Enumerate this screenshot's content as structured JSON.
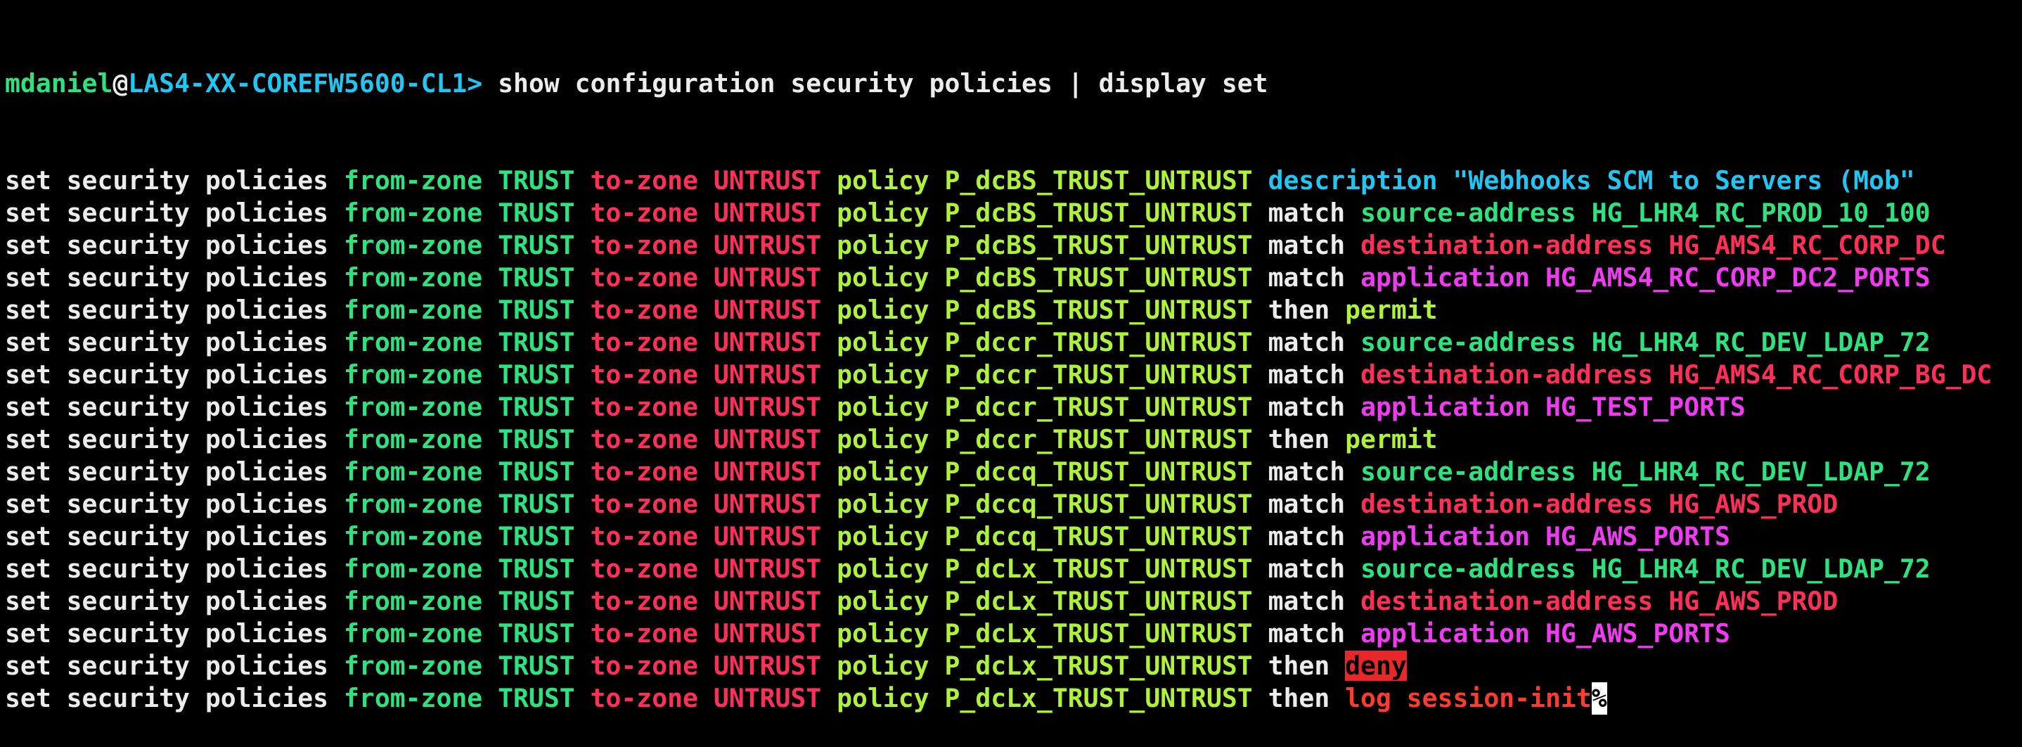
{
  "prompt": {
    "user": "mdaniel",
    "at": "@",
    "host": "LAS4-XX-COREFW5600-CL1",
    "symbol": "> ",
    "command": "show configuration security policies | display set"
  },
  "kw": {
    "set": "set security policies ",
    "from_zone": "from-zone ",
    "from_val": "TRUST ",
    "to_zone": "to-zone ",
    "to_val": "UNTRUST ",
    "policy": "policy ",
    "match": "match ",
    "then": "then "
  },
  "lines": [
    {
      "name": "P_dcBS_TRUST_UNTRUST ",
      "type": "description",
      "label": "description ",
      "value": "\"Webhooks SCM to Servers (Mob\""
    },
    {
      "name": "P_dcBS_TRUST_UNTRUST ",
      "type": "source",
      "label": "source-address ",
      "value": "HG_LHR4_RC_PROD_10_100"
    },
    {
      "name": "P_dcBS_TRUST_UNTRUST ",
      "type": "destination",
      "label": "destination-address ",
      "value": "HG_AMS4_RC_CORP_DC"
    },
    {
      "name": "P_dcBS_TRUST_UNTRUST ",
      "type": "application",
      "label": "application ",
      "value": "HG_AMS4_RC_CORP_DC2_PORTS"
    },
    {
      "name": "P_dcBS_TRUST_UNTRUST ",
      "type": "permit",
      "value": "permit"
    },
    {
      "name": "P_dccr_TRUST_UNTRUST ",
      "type": "source",
      "label": "source-address ",
      "value": "HG_LHR4_RC_DEV_LDAP_72"
    },
    {
      "name": "P_dccr_TRUST_UNTRUST ",
      "type": "destination",
      "label": "destination-address ",
      "value": "HG_AMS4_RC_CORP_BG_DC"
    },
    {
      "name": "P_dccr_TRUST_UNTRUST ",
      "type": "application",
      "label": "application ",
      "value": "HG_TEST_PORTS"
    },
    {
      "name": "P_dccr_TRUST_UNTRUST ",
      "type": "permit",
      "value": "permit"
    },
    {
      "name": "P_dccq_TRUST_UNTRUST ",
      "type": "source",
      "label": "source-address ",
      "value": "HG_LHR4_RC_DEV_LDAP_72"
    },
    {
      "name": "P_dccq_TRUST_UNTRUST ",
      "type": "destination",
      "label": "destination-address ",
      "value": "HG_AWS_PROD"
    },
    {
      "name": "P_dccq_TRUST_UNTRUST ",
      "type": "application",
      "label": "application ",
      "value": "HG_AWS_PORTS"
    },
    {
      "name": "P_dcLx_TRUST_UNTRUST ",
      "type": "source",
      "label": "source-address ",
      "value": "HG_LHR4_RC_DEV_LDAP_72"
    },
    {
      "name": "P_dcLx_TRUST_UNTRUST ",
      "type": "destination",
      "label": "destination-address ",
      "value": "HG_AWS_PROD"
    },
    {
      "name": "P_dcLx_TRUST_UNTRUST ",
      "type": "application",
      "label": "application ",
      "value": "HG_AWS_PORTS"
    },
    {
      "name": "P_dcLx_TRUST_UNTRUST ",
      "type": "deny",
      "value": "deny"
    },
    {
      "name": "P_dcLx_TRUST_UNTRUST ",
      "type": "log",
      "value": "log session-init"
    }
  ],
  "cursor_glyph": "%",
  "colors": {
    "background": "#000000",
    "text": "#ececec",
    "green": "#2de37f",
    "red": "#ff2f5a",
    "lime": "#aef23a",
    "cyan": "#21c6f3",
    "magenta": "#f03bf2",
    "deny_bg": "#e8272b"
  }
}
